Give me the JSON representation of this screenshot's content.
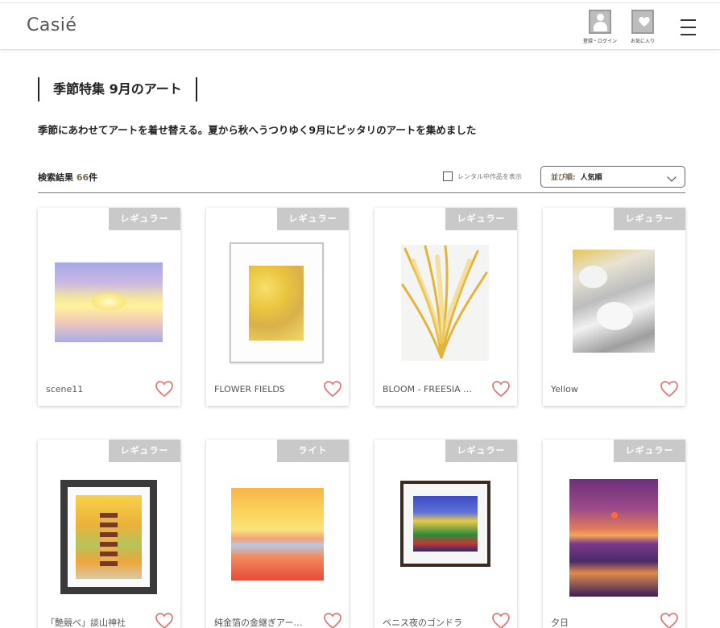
{
  "header": {
    "logo": "Casié",
    "login_label": "登録・ログイン",
    "favorites_label": "お気に入り",
    "icons": [
      "user-icon",
      "heart-icon",
      "menu-icon"
    ]
  },
  "page": {
    "title": "季節特集 9月のアート",
    "lead": "季節にあわせてアートを着せ替える。夏から秋へうつりゆく9月にピッタリのアートを集めました"
  },
  "results": {
    "prefix": "検索結果",
    "count": "66",
    "suffix": "件",
    "rental_filter_label": "レンタル中作品を表示",
    "rental_filter_checked": false,
    "sort_label": "並び順:",
    "sort_value": "人気順"
  },
  "colors": {
    "accent": "#7a6a4e",
    "heart": "#e07a7a",
    "badge": "#c9c9c9"
  },
  "cards": [
    {
      "badge": "レギュラー",
      "name": "scene11"
    },
    {
      "badge": "レギュラー",
      "name": "FLOWER FIELDS"
    },
    {
      "badge": "レギュラー",
      "name": "BLOOM - FREESIA …"
    },
    {
      "badge": "レギュラー",
      "name": "Yellow"
    },
    {
      "badge": "レギュラー",
      "name": "「艶競べ」談山神社"
    },
    {
      "badge": "ライト",
      "name": "純金箔の金継ぎアー…"
    },
    {
      "badge": "レギュラー",
      "name": "ベニス夜のゴンドラ"
    },
    {
      "badge": "レギュラー",
      "name": "夕日"
    }
  ]
}
